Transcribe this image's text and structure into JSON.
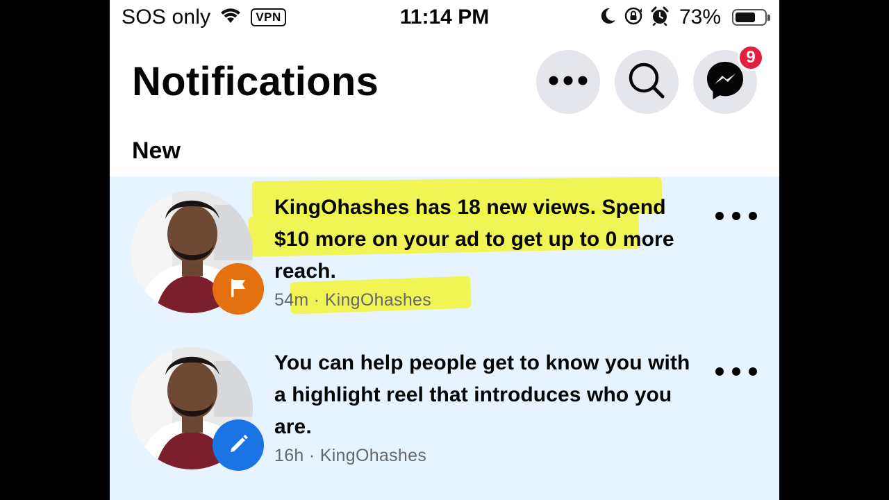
{
  "status_bar": {
    "carrier": "SOS only",
    "vpn": "VPN",
    "time": "11:14 PM",
    "battery_percent": "73%",
    "battery_level": 0.73
  },
  "header": {
    "title": "Notifications",
    "messenger_badge_count": "9"
  },
  "section": {
    "label": "New"
  },
  "notifications": [
    {
      "text": "KingOhashes has 18 new views. Spend $10 more on your ad to get up to 0 more reach.",
      "meta": "54m · KingOhashes",
      "badge_icon": "flag-icon",
      "badge_color": "#e4700f",
      "highlighted": true
    },
    {
      "text": "You can help people get to know you with a highlight reel that introduces who you are.",
      "meta": "16h · KingOhashes",
      "badge_icon": "pencil-icon",
      "badge_color": "#1b74e4",
      "highlighted": false
    }
  ],
  "colors": {
    "unread_background": "#e7f3ff",
    "header_button": "#e4e6eb",
    "badge_red": "#e41e3f",
    "highlight": "#f2f52a"
  }
}
